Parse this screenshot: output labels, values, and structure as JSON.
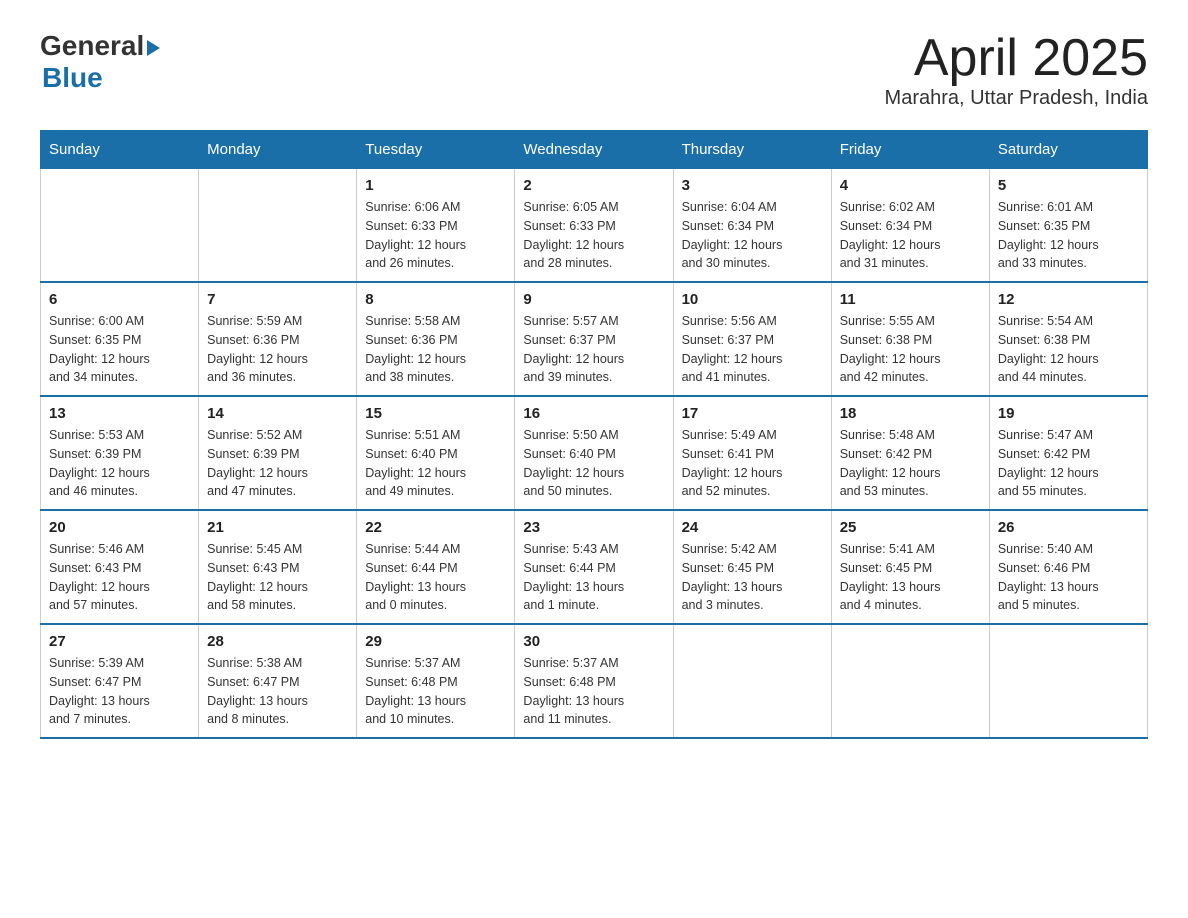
{
  "logo": {
    "general": "General",
    "blue": "Blue",
    "arrow": "▶"
  },
  "title": "April 2025",
  "subtitle": "Marahra, Uttar Pradesh, India",
  "days_of_week": [
    "Sunday",
    "Monday",
    "Tuesday",
    "Wednesday",
    "Thursday",
    "Friday",
    "Saturday"
  ],
  "weeks": [
    [
      {
        "day": "",
        "info": ""
      },
      {
        "day": "",
        "info": ""
      },
      {
        "day": "1",
        "info": "Sunrise: 6:06 AM\nSunset: 6:33 PM\nDaylight: 12 hours\nand 26 minutes."
      },
      {
        "day": "2",
        "info": "Sunrise: 6:05 AM\nSunset: 6:33 PM\nDaylight: 12 hours\nand 28 minutes."
      },
      {
        "day": "3",
        "info": "Sunrise: 6:04 AM\nSunset: 6:34 PM\nDaylight: 12 hours\nand 30 minutes."
      },
      {
        "day": "4",
        "info": "Sunrise: 6:02 AM\nSunset: 6:34 PM\nDaylight: 12 hours\nand 31 minutes."
      },
      {
        "day": "5",
        "info": "Sunrise: 6:01 AM\nSunset: 6:35 PM\nDaylight: 12 hours\nand 33 minutes."
      }
    ],
    [
      {
        "day": "6",
        "info": "Sunrise: 6:00 AM\nSunset: 6:35 PM\nDaylight: 12 hours\nand 34 minutes."
      },
      {
        "day": "7",
        "info": "Sunrise: 5:59 AM\nSunset: 6:36 PM\nDaylight: 12 hours\nand 36 minutes."
      },
      {
        "day": "8",
        "info": "Sunrise: 5:58 AM\nSunset: 6:36 PM\nDaylight: 12 hours\nand 38 minutes."
      },
      {
        "day": "9",
        "info": "Sunrise: 5:57 AM\nSunset: 6:37 PM\nDaylight: 12 hours\nand 39 minutes."
      },
      {
        "day": "10",
        "info": "Sunrise: 5:56 AM\nSunset: 6:37 PM\nDaylight: 12 hours\nand 41 minutes."
      },
      {
        "day": "11",
        "info": "Sunrise: 5:55 AM\nSunset: 6:38 PM\nDaylight: 12 hours\nand 42 minutes."
      },
      {
        "day": "12",
        "info": "Sunrise: 5:54 AM\nSunset: 6:38 PM\nDaylight: 12 hours\nand 44 minutes."
      }
    ],
    [
      {
        "day": "13",
        "info": "Sunrise: 5:53 AM\nSunset: 6:39 PM\nDaylight: 12 hours\nand 46 minutes."
      },
      {
        "day": "14",
        "info": "Sunrise: 5:52 AM\nSunset: 6:39 PM\nDaylight: 12 hours\nand 47 minutes."
      },
      {
        "day": "15",
        "info": "Sunrise: 5:51 AM\nSunset: 6:40 PM\nDaylight: 12 hours\nand 49 minutes."
      },
      {
        "day": "16",
        "info": "Sunrise: 5:50 AM\nSunset: 6:40 PM\nDaylight: 12 hours\nand 50 minutes."
      },
      {
        "day": "17",
        "info": "Sunrise: 5:49 AM\nSunset: 6:41 PM\nDaylight: 12 hours\nand 52 minutes."
      },
      {
        "day": "18",
        "info": "Sunrise: 5:48 AM\nSunset: 6:42 PM\nDaylight: 12 hours\nand 53 minutes."
      },
      {
        "day": "19",
        "info": "Sunrise: 5:47 AM\nSunset: 6:42 PM\nDaylight: 12 hours\nand 55 minutes."
      }
    ],
    [
      {
        "day": "20",
        "info": "Sunrise: 5:46 AM\nSunset: 6:43 PM\nDaylight: 12 hours\nand 57 minutes."
      },
      {
        "day": "21",
        "info": "Sunrise: 5:45 AM\nSunset: 6:43 PM\nDaylight: 12 hours\nand 58 minutes."
      },
      {
        "day": "22",
        "info": "Sunrise: 5:44 AM\nSunset: 6:44 PM\nDaylight: 13 hours\nand 0 minutes."
      },
      {
        "day": "23",
        "info": "Sunrise: 5:43 AM\nSunset: 6:44 PM\nDaylight: 13 hours\nand 1 minute."
      },
      {
        "day": "24",
        "info": "Sunrise: 5:42 AM\nSunset: 6:45 PM\nDaylight: 13 hours\nand 3 minutes."
      },
      {
        "day": "25",
        "info": "Sunrise: 5:41 AM\nSunset: 6:45 PM\nDaylight: 13 hours\nand 4 minutes."
      },
      {
        "day": "26",
        "info": "Sunrise: 5:40 AM\nSunset: 6:46 PM\nDaylight: 13 hours\nand 5 minutes."
      }
    ],
    [
      {
        "day": "27",
        "info": "Sunrise: 5:39 AM\nSunset: 6:47 PM\nDaylight: 13 hours\nand 7 minutes."
      },
      {
        "day": "28",
        "info": "Sunrise: 5:38 AM\nSunset: 6:47 PM\nDaylight: 13 hours\nand 8 minutes."
      },
      {
        "day": "29",
        "info": "Sunrise: 5:37 AM\nSunset: 6:48 PM\nDaylight: 13 hours\nand 10 minutes."
      },
      {
        "day": "30",
        "info": "Sunrise: 5:37 AM\nSunset: 6:48 PM\nDaylight: 13 hours\nand 11 minutes."
      },
      {
        "day": "",
        "info": ""
      },
      {
        "day": "",
        "info": ""
      },
      {
        "day": "",
        "info": ""
      }
    ]
  ]
}
